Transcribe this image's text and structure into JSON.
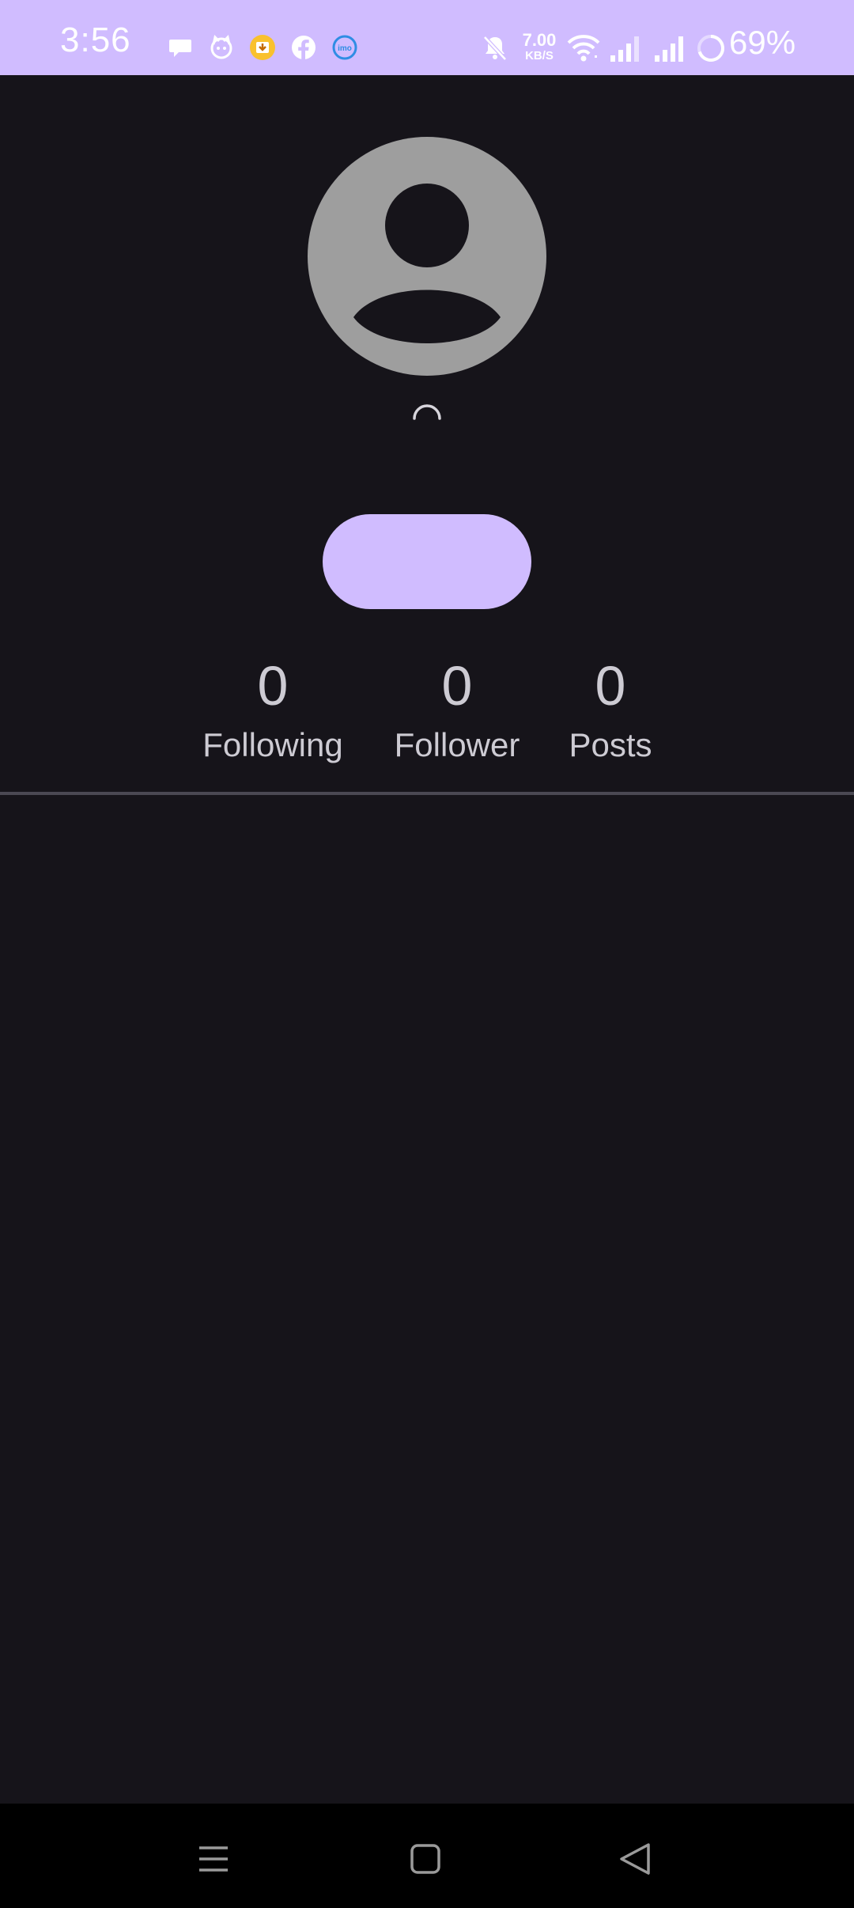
{
  "status_bar": {
    "time": "3:56",
    "network_speed_value": "7.00",
    "network_speed_unit": "KB/S",
    "battery_percent": "69%",
    "background_color": "#d0bcff",
    "notification_icons": [
      "chat-bubble-icon",
      "cat-face-icon",
      "download-badge-icon",
      "facebook-icon",
      "imo-icon"
    ],
    "system_icons": [
      "bell-muted-icon",
      "wifi-icon",
      "signal-sim1-icon",
      "signal-sim2-icon",
      "battery-ring-icon"
    ]
  },
  "profile": {
    "avatar_icon": "default-avatar-icon",
    "loading_icon": "loading-spinner-icon",
    "action_button_label": "",
    "accent_color": "#d0bcff",
    "stats": [
      {
        "value": "0",
        "label": "Following"
      },
      {
        "value": "0",
        "label": "Follower"
      },
      {
        "value": "0",
        "label": "Posts"
      }
    ]
  },
  "nav_bar": {
    "buttons": [
      "menu-icon",
      "home-icon",
      "back-icon"
    ]
  }
}
